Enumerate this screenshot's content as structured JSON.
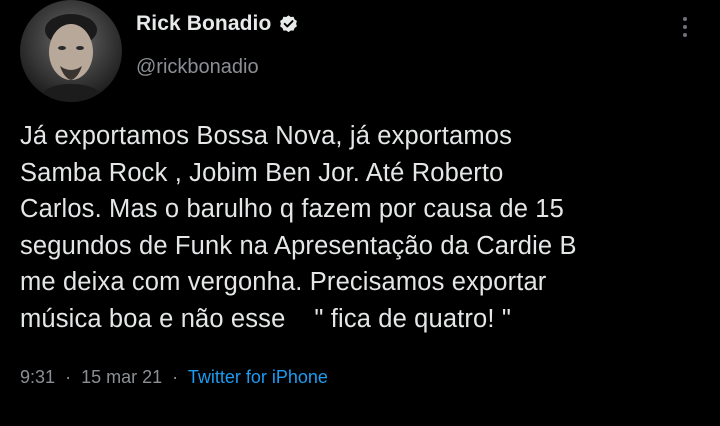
{
  "author": {
    "display_name": "Rick Bonadio",
    "handle": "@rickbonadio",
    "verified_icon": "verified-badge-icon",
    "avatar_icon": "profile-photo"
  },
  "tweet": {
    "text": "Já exportamos Bossa Nova, já exportamos\nSamba Rock , Jobim Ben Jor. Até Roberto\nCarlos. Mas o barulho q fazem por causa de 15\nsegundos de Funk na Apresentação da Cardie B\nme deixa com vergonha. Precisamos exportar\nmúsica boa e não esse    \" fica de quatro! \"",
    "time": "9:31",
    "date": "15 mar 21",
    "separator": "·",
    "source": "Twitter for iPhone"
  },
  "menu": {
    "icon": "more-vertical-icon"
  },
  "colors": {
    "background": "#000000",
    "text": "#e4e6e7",
    "secondary_text": "#8b8f94",
    "link": "#1d9bf0"
  }
}
